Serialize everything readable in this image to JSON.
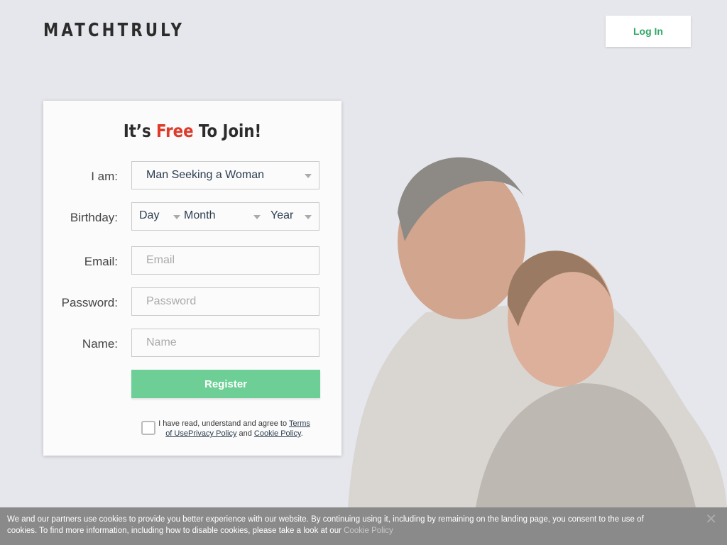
{
  "header": {
    "logo": "MATCHTRULY",
    "login_label": "Log In"
  },
  "form": {
    "title_pre": "It’s ",
    "title_free": "Free",
    "title_post": " To Join!",
    "iam_label": "I am:",
    "iam_value": "Man Seeking a Woman",
    "birthday_label": "Birthday:",
    "day": "Day",
    "month": "Month",
    "year": "Year",
    "email_label": "Email:",
    "email_placeholder": "Email",
    "password_label": "Password:",
    "password_placeholder": "Password",
    "name_label": "Name:",
    "name_placeholder": "Name",
    "register_label": "Register",
    "agree_text": "I have read, understand and agree to ",
    "terms_link": "Terms of Use",
    "privacy_link": "Privacy Policy",
    "and_text": " and ",
    "cookie_link": "Cookie Policy",
    "period": "."
  },
  "cookie_banner": {
    "text": "We and our partners use cookies to provide you better experience with our website. By continuing using it, including by remaining on the landing page, you consent to the use of cookies. To find more information, including how to disable cookies, please take a look at our ",
    "link": "Cookie Policy",
    "close_icon": "close-icon"
  },
  "colors": {
    "accent": "#6dcf96",
    "login_text": "#2fa865",
    "free": "#e03a2a"
  }
}
